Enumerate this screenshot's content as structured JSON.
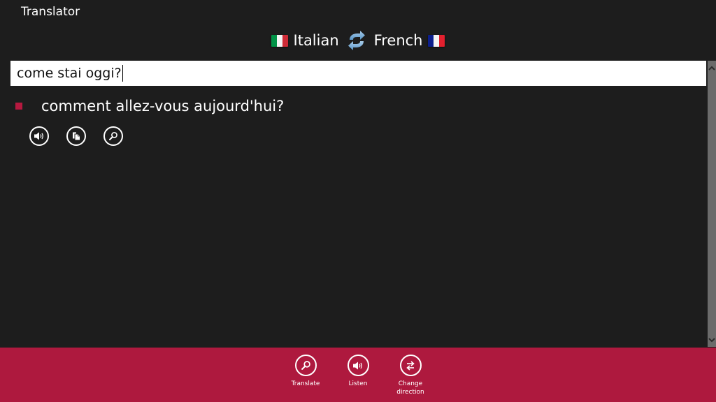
{
  "app": {
    "title": "Translator"
  },
  "languages": {
    "source": {
      "label": "Italian",
      "flag_icon": "italy-flag-icon",
      "flag_colors": [
        "#009246",
        "#ffffff",
        "#ce2b37"
      ]
    },
    "target": {
      "label": "French",
      "flag_icon": "france-flag-icon",
      "flag_colors": [
        "#0d1f8c",
        "#ffffff",
        "#e3202e"
      ]
    },
    "swap_icon": "swap-arrows-icon"
  },
  "input": {
    "value": "come stai oggi?",
    "placeholder": ""
  },
  "result": {
    "text": "comment allez-vous aujourd'hui?",
    "bullet_color": "#b5193f",
    "actions": [
      {
        "name": "listen",
        "icon": "speaker-icon"
      },
      {
        "name": "copy",
        "icon": "copy-icon"
      },
      {
        "name": "search",
        "icon": "search-icon"
      }
    ]
  },
  "app_bar": {
    "background": "#ae193e",
    "buttons": [
      {
        "label": "Translate",
        "icon": "search-icon"
      },
      {
        "label": "Listen",
        "icon": "speaker-icon"
      },
      {
        "label": "Change\ndirection",
        "icon": "swap-direction-icon"
      }
    ]
  },
  "scrollbar": {
    "up_icon": "chevron-up-icon",
    "down_icon": "chevron-down-icon"
  }
}
